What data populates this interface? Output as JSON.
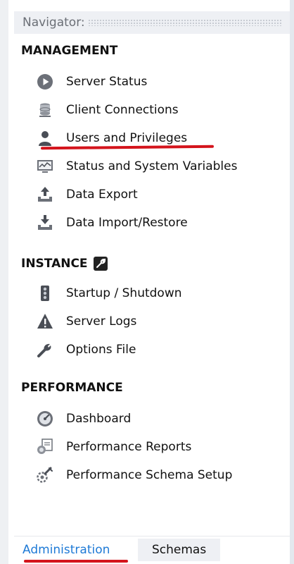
{
  "navigator": {
    "title": "Navigator:"
  },
  "management": {
    "title": "MANAGEMENT",
    "items": [
      {
        "label": "Server Status",
        "icon": "play-circle-icon"
      },
      {
        "label": "Client Connections",
        "icon": "database-icon"
      },
      {
        "label": "Users and Privileges",
        "icon": "user-icon"
      },
      {
        "label": "Status and System Variables",
        "icon": "monitor-chart-icon"
      },
      {
        "label": "Data Export",
        "icon": "upload-icon"
      },
      {
        "label": "Data Import/Restore",
        "icon": "download-icon"
      }
    ]
  },
  "instance": {
    "title": "INSTANCE",
    "title_icon": "wrench-icon",
    "items": [
      {
        "label": "Startup / Shutdown",
        "icon": "traffic-light-icon"
      },
      {
        "label": "Server Logs",
        "icon": "warning-icon"
      },
      {
        "label": "Options File",
        "icon": "wrench-icon"
      }
    ]
  },
  "performance": {
    "title": "PERFORMANCE",
    "items": [
      {
        "label": "Dashboard",
        "icon": "gauge-icon"
      },
      {
        "label": "Performance Reports",
        "icon": "reports-icon"
      },
      {
        "label": "Performance Schema Setup",
        "icon": "schema-setup-icon"
      }
    ]
  },
  "tabs": {
    "administration": "Administration",
    "schemas": "Schemas"
  },
  "colors": {
    "accent_red": "#d4141c",
    "link_blue": "#1e7ad6",
    "header_bg": "#eef0f4"
  }
}
